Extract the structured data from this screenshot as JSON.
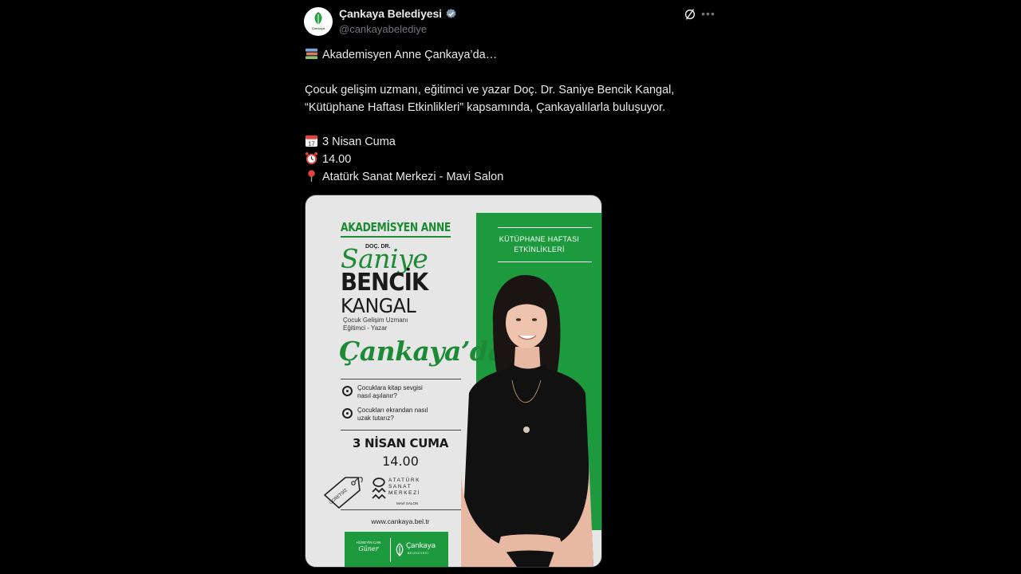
{
  "author": {
    "name": "Çankaya Belediyesi",
    "handle": "@cankayabelediye",
    "avatar_text": "Çankaya"
  },
  "icons": {
    "verified": "verified-badge-icon",
    "grok": "grok-icon",
    "more": "more-icon"
  },
  "tweet": {
    "line1": "Akademisyen Anne Çankaya’da…",
    "line2": "Çocuk gelişim uzmanı, eğitimci ve yazar Doç. Dr. Saniye Bencik Kangal,",
    "line3": "“Kütüphane Haftası Etkinlikleri” kapsamında, Çankayalılarla buluşuyor.",
    "date": "3 Nisan Cuma",
    "time": "14.00",
    "place": "Atatürk Sanat Merkezi - Mavi Salon"
  },
  "poster": {
    "event_title": "AKADEMİSYEN ANNE",
    "kutuphane_line1": "KÜTÜPHANE HAFTASI",
    "kutuphane_line2": "ETKİNLİKLERİ",
    "title_prefix": "DOÇ. DR.",
    "first_name": "Saniye",
    "middle_name": "BENCİK",
    "last_name": "KANGAL",
    "role_line1": "Çocuk Gelişim Uzmanı",
    "role_line2": "Eğitimci - Yazar",
    "location_script": "Çankaya’da",
    "q1_line1": "Çocuklara kitap sevgisi",
    "q1_line2": "nasıl aşılanır?",
    "q2_line1": "Çocukları ekrandan nasıl",
    "q2_line2": "uzak tutarız?",
    "date": "3 NİSAN CUMA",
    "time": "14.00",
    "free_tag": "ÜCRETSİZ",
    "venue_line1": "ATATÜRK",
    "venue_line2": "SANAT",
    "venue_line3": "MERKEZİ",
    "venue_hall": "MAVİ SALON",
    "website": "www.cankaya.bel.tr",
    "footer_left_line1": "HÜSEYİN CAN",
    "footer_left_line2": "Güner",
    "footer_right": "Çankaya",
    "footer_right_sub": "BELEDİYESİ"
  },
  "colors": {
    "background": "#000000",
    "text": "#e7e9ea",
    "muted": "#71767b",
    "poster_green": "#1d9a3e",
    "verified_badge": "#829aab"
  }
}
